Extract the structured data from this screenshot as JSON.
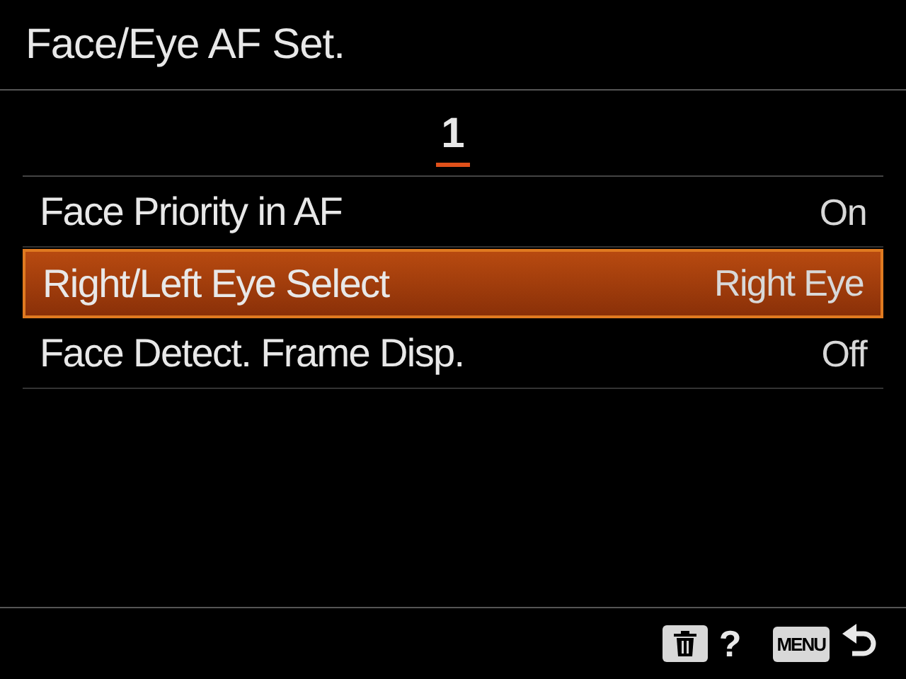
{
  "window": {
    "title": "Face/Eye AF Set."
  },
  "tabs": [
    {
      "label": "1",
      "selected": true
    }
  ],
  "rows": [
    {
      "label": "Face Priority in AF",
      "value": "On",
      "selected": false
    },
    {
      "label": "Right/Left Eye Select",
      "value": "Right Eye",
      "selected": true
    },
    {
      "label": "Face Detect. Frame Disp.",
      "value": "Off",
      "selected": false
    }
  ],
  "footer": {
    "help": "?",
    "menu_key": "MENU"
  }
}
